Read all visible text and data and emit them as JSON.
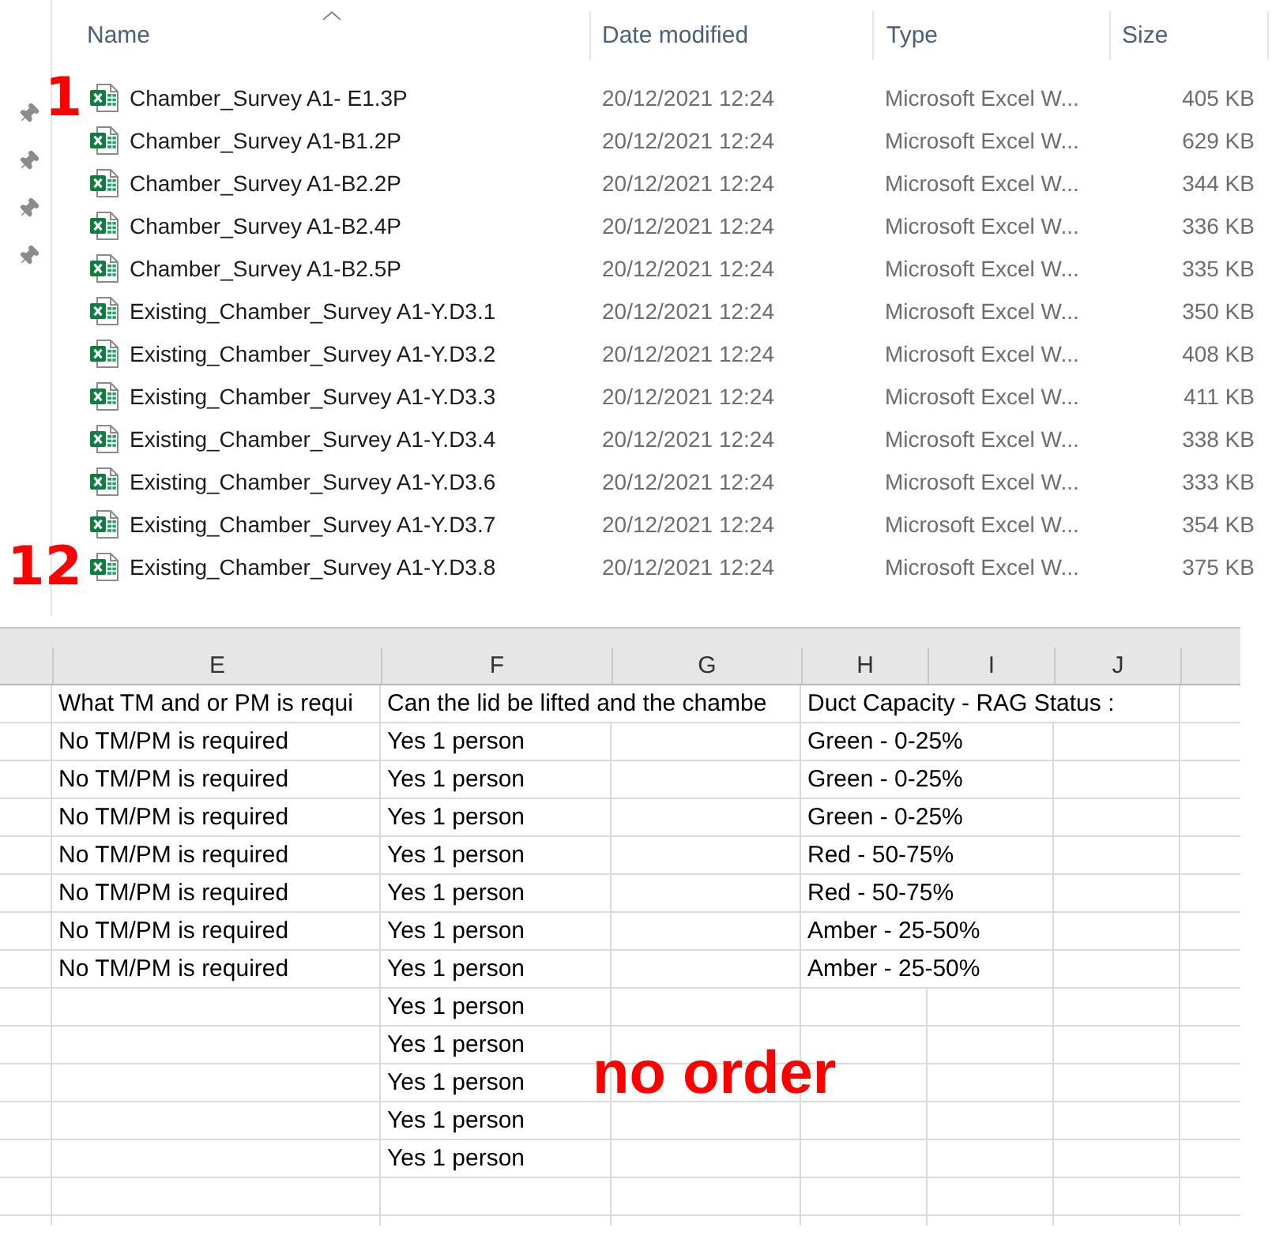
{
  "file_list": {
    "columns": [
      {
        "label": "Name",
        "sorted": true
      },
      {
        "label": "Date modified",
        "sorted": false
      },
      {
        "label": "Type",
        "sorted": false
      },
      {
        "label": "Size",
        "sorted": false
      }
    ],
    "files": [
      {
        "name": "Chamber_Survey A1- E1.3P",
        "date_modified": "20/12/2021 12:24",
        "type": "Microsoft Excel W...",
        "size": "405 KB",
        "annotation": "1"
      },
      {
        "name": "Chamber_Survey A1-B1.2P",
        "date_modified": "20/12/2021 12:24",
        "type": "Microsoft Excel W...",
        "size": "629 KB"
      },
      {
        "name": "Chamber_Survey A1-B2.2P",
        "date_modified": "20/12/2021 12:24",
        "type": "Microsoft Excel W...",
        "size": "344 KB"
      },
      {
        "name": "Chamber_Survey A1-B2.4P",
        "date_modified": "20/12/2021 12:24",
        "type": "Microsoft Excel W...",
        "size": "336 KB"
      },
      {
        "name": "Chamber_Survey A1-B2.5P",
        "date_modified": "20/12/2021 12:24",
        "type": "Microsoft Excel W...",
        "size": "335 KB"
      },
      {
        "name": "Existing_Chamber_Survey A1-Y.D3.1",
        "date_modified": "20/12/2021 12:24",
        "type": "Microsoft Excel W...",
        "size": "350 KB"
      },
      {
        "name": "Existing_Chamber_Survey A1-Y.D3.2",
        "date_modified": "20/12/2021 12:24",
        "type": "Microsoft Excel W...",
        "size": "408 KB"
      },
      {
        "name": "Existing_Chamber_Survey A1-Y.D3.3",
        "date_modified": "20/12/2021 12:24",
        "type": "Microsoft Excel W...",
        "size": "411 KB"
      },
      {
        "name": "Existing_Chamber_Survey A1-Y.D3.4",
        "date_modified": "20/12/2021 12:24",
        "type": "Microsoft Excel W...",
        "size": "338 KB"
      },
      {
        "name": "Existing_Chamber_Survey A1-Y.D3.6",
        "date_modified": "20/12/2021 12:24",
        "type": "Microsoft Excel W...",
        "size": "333 KB"
      },
      {
        "name": "Existing_Chamber_Survey A1-Y.D3.7",
        "date_modified": "20/12/2021 12:24",
        "type": "Microsoft Excel W...",
        "size": "354 KB"
      },
      {
        "name": "Existing_Chamber_Survey A1-Y.D3.8",
        "date_modified": "20/12/2021 12:24",
        "type": "Microsoft Excel W...",
        "size": "375 KB",
        "annotation": "12"
      }
    ]
  },
  "spreadsheet": {
    "columns": [
      {
        "label": "E"
      },
      {
        "label": "F"
      },
      {
        "label": "G"
      },
      {
        "label": "H"
      },
      {
        "label": "I"
      },
      {
        "label": "J"
      }
    ],
    "rows": [
      {
        "column_e": "What TM and or PM is requi",
        "column_f": "Can the lid be lifted and the chambe",
        "column_h": "Duct Capacity - RAG Status :"
      },
      {
        "column_e": "No TM/PM is required",
        "column_f": "Yes 1 person",
        "column_h": "Green - 0-25%"
      },
      {
        "column_e": "No TM/PM is required",
        "column_f": "Yes 1 person",
        "column_h": "Green - 0-25%"
      },
      {
        "column_e": "No TM/PM is required",
        "column_f": "Yes 1 person",
        "column_h": "Green - 0-25%"
      },
      {
        "column_e": "No TM/PM is required",
        "column_f": "Yes 1 person",
        "column_h": "Red - 50-75%"
      },
      {
        "column_e": "No TM/PM is required",
        "column_f": "Yes 1 person",
        "column_h": "Red - 50-75%"
      },
      {
        "column_e": "No TM/PM is required",
        "column_f": "Yes 1 person",
        "column_h": "Amber - 25-50%"
      },
      {
        "column_e": "No TM/PM is required",
        "column_f": "Yes 1 person",
        "column_h": "Amber - 25-50%"
      },
      {
        "column_f": "Yes 1 person"
      },
      {
        "column_f": "Yes 1 person"
      },
      {
        "column_f": "Yes 1 person"
      },
      {
        "column_f": "Yes 1 person"
      },
      {
        "column_f": "Yes 1 person"
      }
    ],
    "annotation": "no order"
  }
}
